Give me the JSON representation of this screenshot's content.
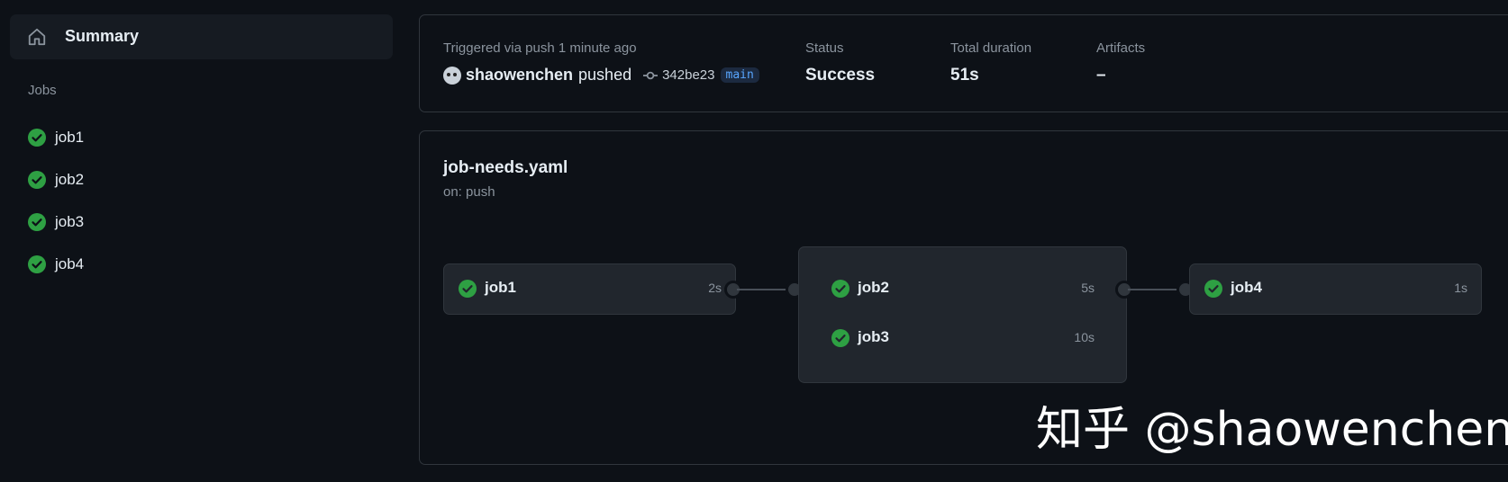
{
  "sidebar": {
    "summary_label": "Summary",
    "jobs_heading": "Jobs",
    "jobs": [
      {
        "label": "job1",
        "status": "success"
      },
      {
        "label": "job2",
        "status": "success"
      },
      {
        "label": "job3",
        "status": "success"
      },
      {
        "label": "job4",
        "status": "success"
      }
    ]
  },
  "summary": {
    "trigger_text": "Triggered via push 1 minute ago",
    "actor": "shaowenchen",
    "action": "pushed",
    "commit_sha": "342be23",
    "branch": "main",
    "status_label": "Status",
    "status_value": "Success",
    "duration_label": "Total duration",
    "duration_value": "51s",
    "artifacts_label": "Artifacts",
    "artifacts_value": "–"
  },
  "workflow": {
    "title": "job-needs.yaml",
    "subtitle": "on: push",
    "jobs": [
      {
        "name": "job1",
        "duration": "2s"
      },
      {
        "name": "job2",
        "duration": "5s"
      },
      {
        "name": "job3",
        "duration": "10s"
      },
      {
        "name": "job4",
        "duration": "1s"
      }
    ]
  },
  "watermark": "知乎 @shaowenchen",
  "colors": {
    "background": "#0d1117",
    "panel": "#161b22",
    "job_box": "#21262d",
    "success": "#2ea043",
    "branch_text": "#58a6ff"
  }
}
